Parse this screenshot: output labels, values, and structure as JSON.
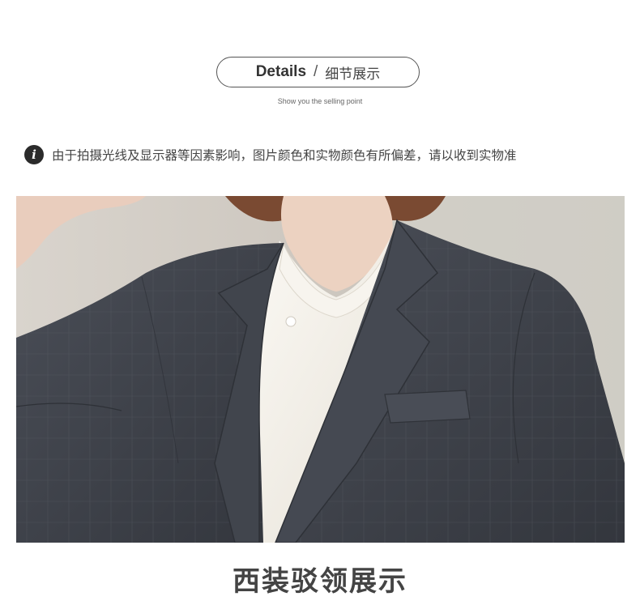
{
  "header": {
    "details_en": "Details",
    "separator": "/",
    "details_cn": "细节展示",
    "subtitle": "Show you the selling point"
  },
  "notice": {
    "icon": "info-icon",
    "icon_glyph": "i",
    "text": "由于拍摄光线及显示器等因素影响，图片颜色和实物颜色有所偏差，请以收到实物准"
  },
  "photo": {
    "description_icon": "product-photo"
  },
  "caption": {
    "text": "西装驳领展示"
  },
  "colors": {
    "accent_text": "#333333",
    "blazer": "#3f434c",
    "shirt": "#f4f1ea"
  }
}
